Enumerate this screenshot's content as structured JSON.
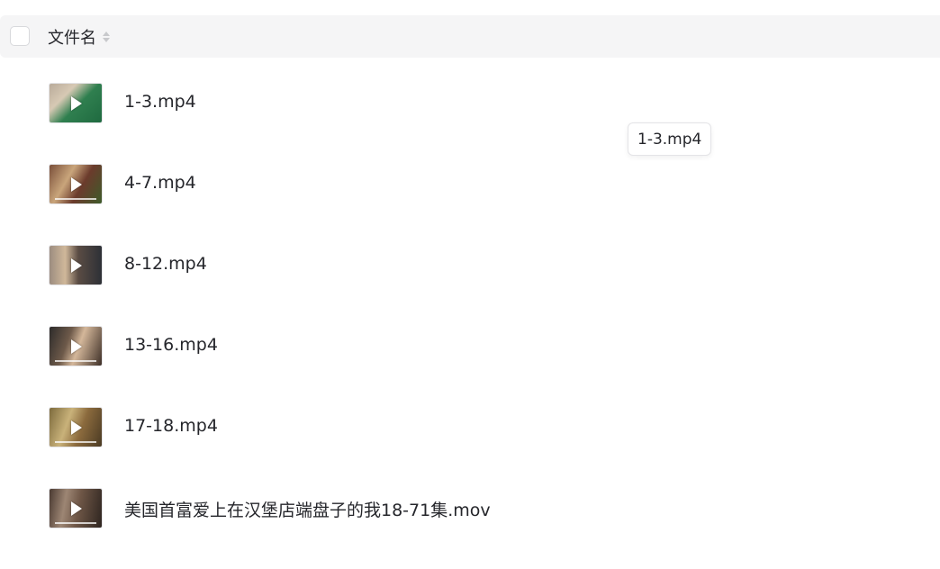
{
  "header": {
    "column_title": "文件名",
    "sort_icon": "sort-icon"
  },
  "files": [
    {
      "name": "1-3.mp4"
    },
    {
      "name": "4-7.mp4"
    },
    {
      "name": "8-12.mp4"
    },
    {
      "name": "13-16.mp4"
    },
    {
      "name": "17-18.mp4"
    },
    {
      "name": "美国首富爱上在汉堡店端盘子的我18-71集.mov"
    }
  ],
  "tooltip": {
    "text": "1-3.mp4"
  },
  "colors": {
    "header_bg": "#f5f5f6",
    "text": "#25262b",
    "muted_icon": "#c8c9cc"
  }
}
